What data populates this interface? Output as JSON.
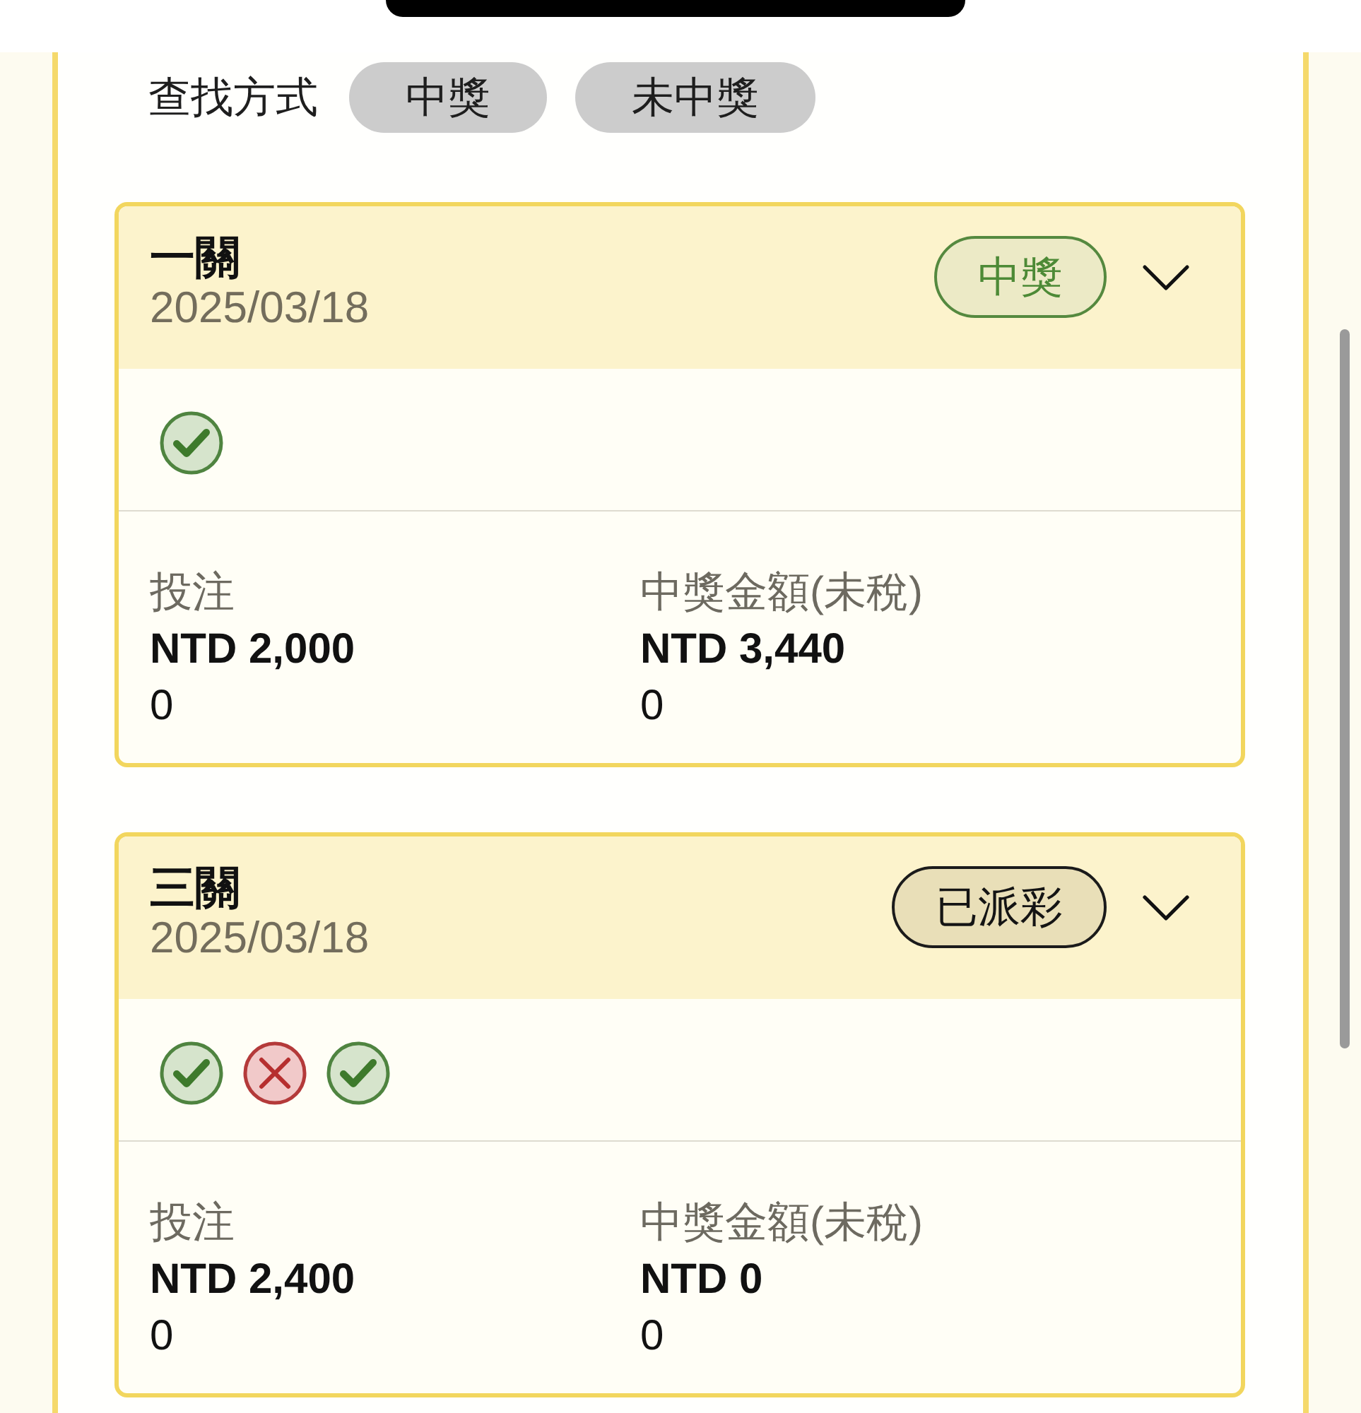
{
  "filter": {
    "label": "查找方式",
    "options": [
      {
        "label": "中獎",
        "selected": false
      },
      {
        "label": "未中獎",
        "selected": false
      }
    ]
  },
  "tickets": [
    {
      "title": "一關",
      "date": "2025/03/18",
      "status": {
        "label": "中獎",
        "kind": "won"
      },
      "legs": [
        {
          "kind": "win"
        }
      ],
      "fields": [
        {
          "label": "投注",
          "amount": "NTD 2,000",
          "value": "0"
        },
        {
          "label": "中獎金額(未稅)",
          "amount": "NTD 3,440",
          "value": "0"
        }
      ]
    },
    {
      "title": "三關",
      "date": "2025/03/18",
      "status": {
        "label": "已派彩",
        "kind": "paid"
      },
      "legs": [
        {
          "kind": "win"
        },
        {
          "kind": "lose"
        },
        {
          "kind": "win"
        }
      ],
      "fields": [
        {
          "label": "投注",
          "amount": "NTD 2,400",
          "value": "0"
        },
        {
          "label": "中獎金額(未稅)",
          "amount": "NTD 0",
          "value": "0"
        }
      ]
    }
  ]
}
